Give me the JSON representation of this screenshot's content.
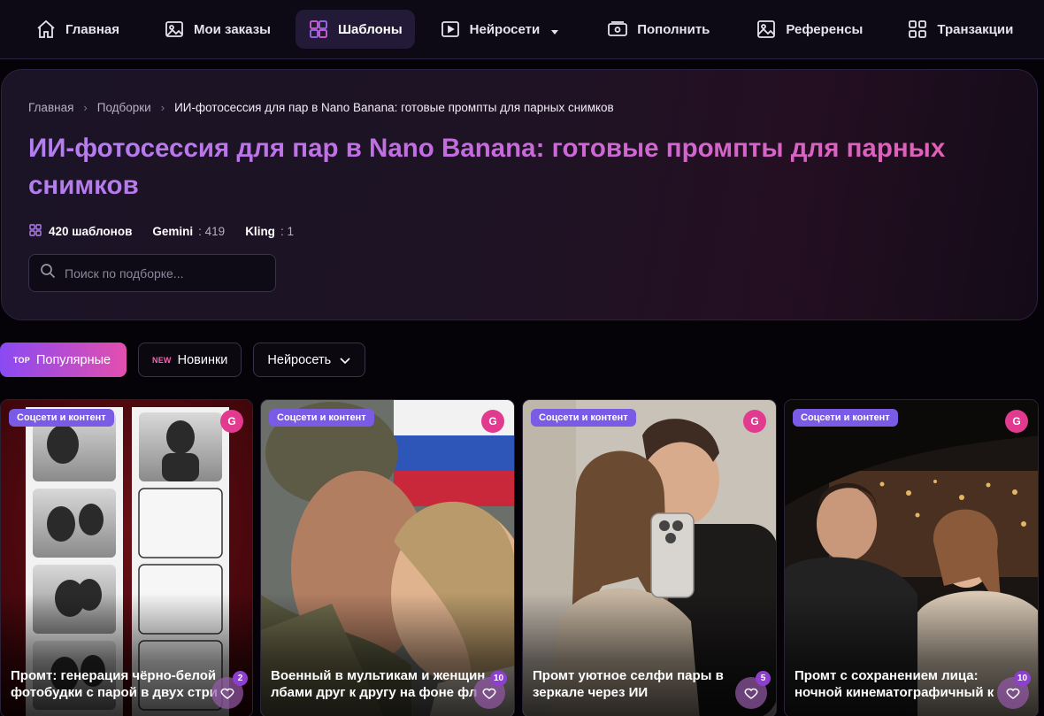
{
  "nav": {
    "items": [
      {
        "label": "Главная",
        "icon": "home-icon"
      },
      {
        "label": "Мои заказы",
        "icon": "image-icon"
      },
      {
        "label": "Шаблоны",
        "icon": "templates-grid-icon",
        "active": true
      },
      {
        "label": "Нейросети",
        "icon": "play-icon",
        "has_dropdown": true
      },
      {
        "label": "Пополнить",
        "icon": "wallet-icon"
      },
      {
        "label": "Референсы",
        "icon": "picture-icon"
      },
      {
        "label": "Транзакции",
        "icon": "grid-icon"
      }
    ]
  },
  "breadcrumb": {
    "items": [
      "Главная",
      "Подборки"
    ],
    "current": "ИИ-фотосессия для пар в Nano Banana: готовые промпты для парных снимков"
  },
  "hero": {
    "title": "ИИ-фотосессия для пар в Nano Banana: готовые промпты для парных снимков",
    "templates_count": "420 шаблонов",
    "models": [
      {
        "name": "Gemini",
        "count": ": 419"
      },
      {
        "name": "Kling",
        "count": ": 1"
      }
    ],
    "search_placeholder": "Поиск по подборке..."
  },
  "filters": {
    "popular": {
      "tag": "TOP",
      "label": "Популярные"
    },
    "new": {
      "tag": "NEW",
      "label": "Новинки"
    },
    "neural": {
      "label": "Нейросеть"
    }
  },
  "cards": [
    {
      "category": "Соцсети и контент",
      "model_badge": "G",
      "title_line1": "Промт: генерация чёрно-белой",
      "title_line2": "фотобудки с парой в двух стри",
      "likes": "2"
    },
    {
      "category": "Соцсети и контент",
      "model_badge": "G",
      "title_line1": "Военный в мультикам и женщин",
      "title_line2": "лбами друг к другу на фоне фл",
      "likes": "10"
    },
    {
      "category": "Соцсети и контент",
      "model_badge": "G",
      "title_line1": "Промт уютное селфи пары в",
      "title_line2": "зеркале через ИИ",
      "likes": "5"
    },
    {
      "category": "Соцсети и контент",
      "model_badge": "G",
      "title_line1": "Промт с сохранением лица:",
      "title_line2": "ночной кинематографичный к",
      "likes": "10"
    }
  ],
  "colors": {
    "accent_purple": "#8a4af3",
    "accent_pink": "#e24fae",
    "badge_purple": "#7a5be6",
    "badge_pink": "#e23a8f"
  }
}
